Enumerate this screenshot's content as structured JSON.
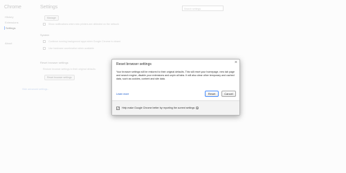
{
  "app": {
    "brand": "Chrome"
  },
  "sidebar": {
    "items": [
      {
        "label": "History"
      },
      {
        "label": "Extensions"
      },
      {
        "label": "Settings"
      },
      {
        "label": "About"
      }
    ]
  },
  "main": {
    "title": "Settings",
    "search_placeholder": "Search settings",
    "manage_button": "Manage",
    "notif_row": "Show notifications when new printers are detected on the network",
    "system_title": "System",
    "system_rows": [
      "Continue running background apps when Google Chrome is closed",
      "Use hardware acceleration when available"
    ],
    "reset_title": "Reset browser settings",
    "reset_desc": "Restore browser settings to their original defaults.",
    "reset_button": "Reset browser settings",
    "hide_advanced": "Hide advanced settings..."
  },
  "dialog": {
    "title": "Reset browser settings",
    "close_glyph": "×",
    "body": "Your browser settings will be restored to their original defaults. This will reset your homepage, new tab page and search engine, disable your extensions and unpin all tabs. It will also clear other temporary and cached data, such as cookies, content and site data.",
    "learn_more": "Learn more",
    "reset_button": "Reset",
    "cancel_button": "Cancel",
    "footer_checkbox_label": "Help make Google Chrome better by reporting the current settings",
    "footer_checked": true,
    "help_icon": "?"
  },
  "colors": {
    "accent": "#4d90fe",
    "link": "#1155cc"
  }
}
